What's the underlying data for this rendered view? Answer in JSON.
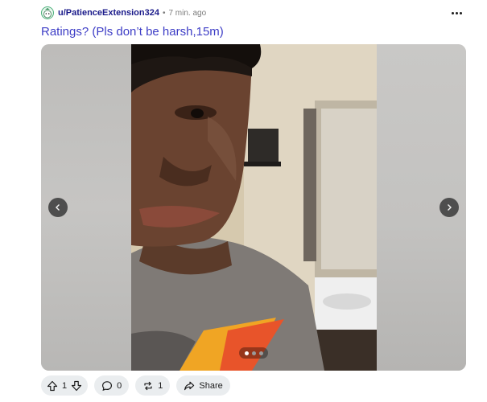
{
  "post": {
    "username": "u/PatienceExtension324",
    "separator": "•",
    "time": "7 min. ago",
    "title": "Ratings? (Pls don’t be harsh,15m)"
  },
  "gallery": {
    "total_images": 3,
    "current_index": 1
  },
  "actions": {
    "score": "1",
    "comments": "0",
    "crossposts": "1",
    "share_label": "Share"
  },
  "colors": {
    "title": "#3d3dc6",
    "username": "#1a1a8a",
    "pill_bg": "#eaedef"
  }
}
